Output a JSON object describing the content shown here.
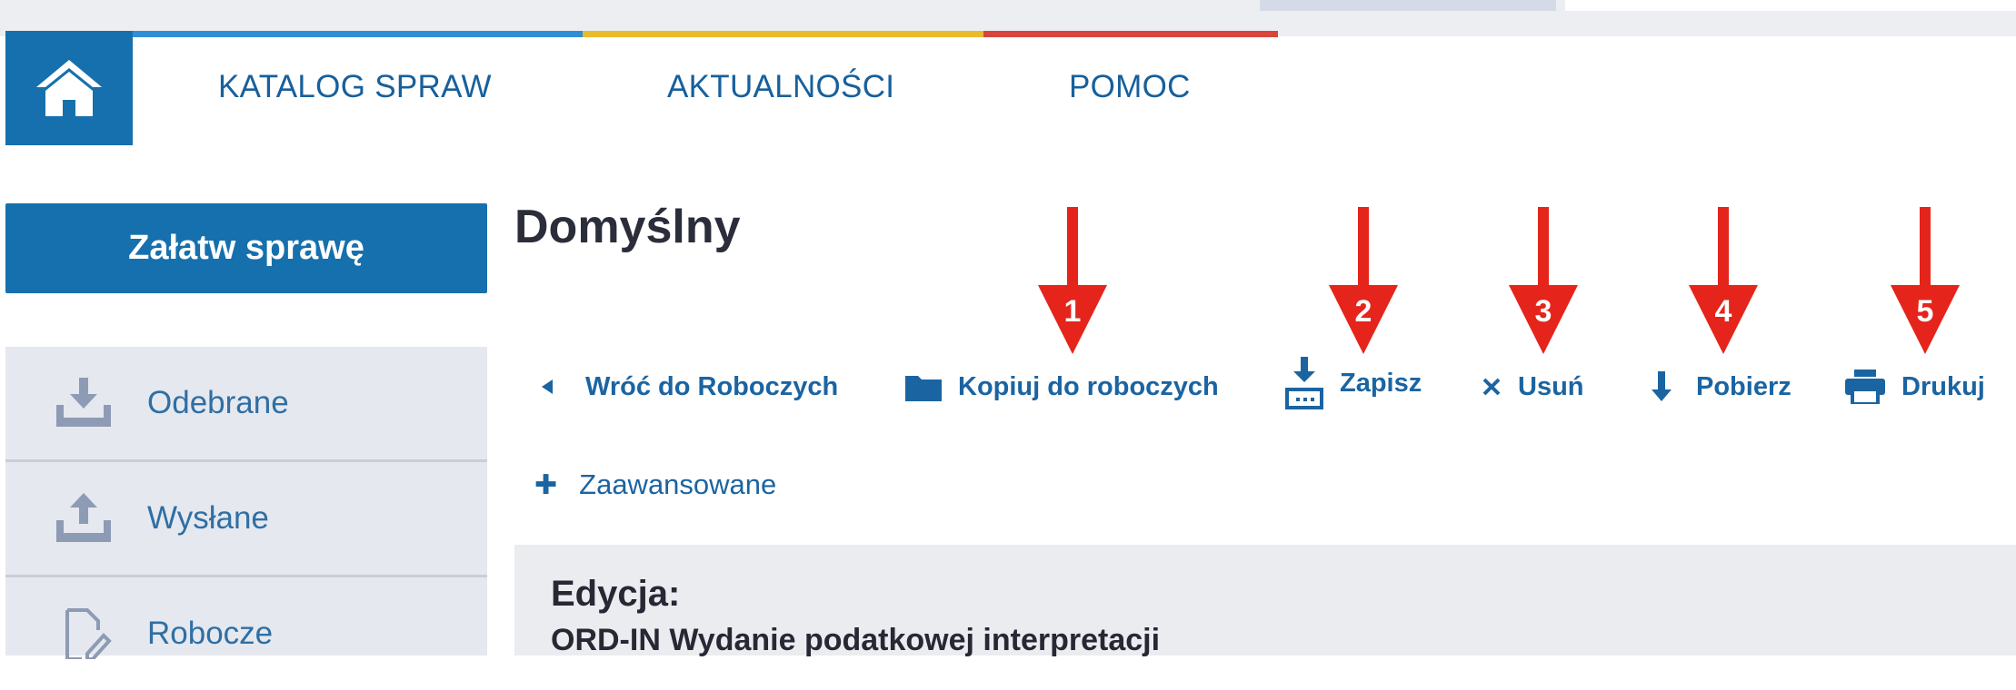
{
  "nav": {
    "items": [
      {
        "label": "KATALOG SPRAW"
      },
      {
        "label": "AKTUALNOŚCI"
      },
      {
        "label": "POMOC"
      }
    ]
  },
  "sidebar": {
    "primary_button": "Załatw sprawę",
    "items": [
      {
        "label": "Odebrane",
        "icon": "inbox-download-icon"
      },
      {
        "label": "Wysłane",
        "icon": "outbox-upload-icon"
      },
      {
        "label": "Robocze",
        "icon": "document-edit-icon"
      }
    ]
  },
  "main": {
    "title": "Domyślny",
    "toolbar": {
      "back": "Wróć do Roboczych",
      "copy": "Kopiuj do roboczych",
      "save": "Zapisz",
      "delete": "Usuń",
      "download": "Pobierz",
      "print": "Drukuj"
    },
    "advanced": "Zaawansowane",
    "edition": {
      "label": "Edycja:",
      "value": "ORD-IN Wydanie podatkowej interpretacji"
    }
  },
  "annotations": [
    "1",
    "2",
    "3",
    "4",
    "5"
  ],
  "colors": {
    "brand": "#1670ad",
    "link": "#1b64a2",
    "accent_blue": "#2e8fd6",
    "accent_yellow": "#e9ba2a",
    "accent_red": "#d9443b",
    "annotation_red": "#e5241b"
  }
}
